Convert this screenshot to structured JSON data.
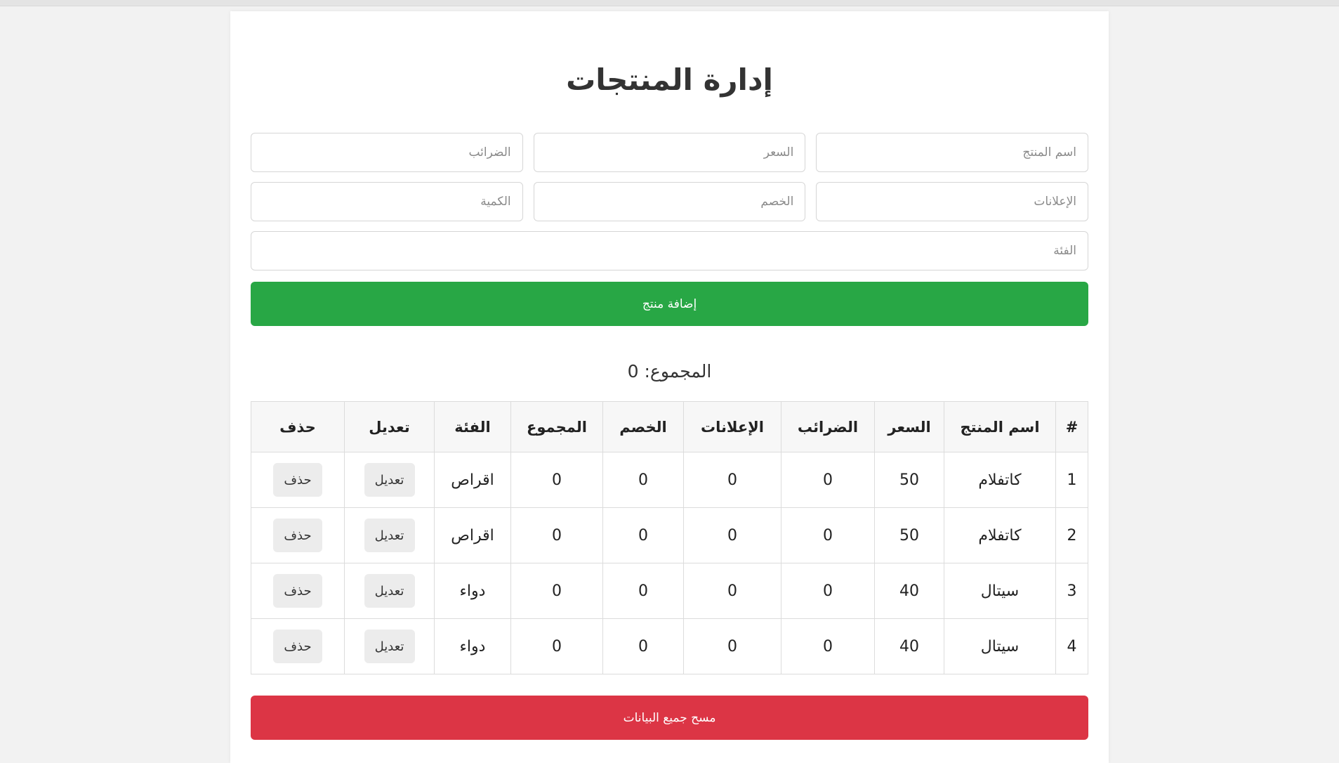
{
  "page": {
    "title": "إدارة المنتجات",
    "total_label": "المجموع: 0"
  },
  "form": {
    "product_name_placeholder": "اسم المنتج",
    "price_placeholder": "السعر",
    "taxes_placeholder": "الضرائب",
    "ads_placeholder": "الإعلانات",
    "discount_placeholder": "الخصم",
    "quantity_placeholder": "الكمية",
    "category_placeholder": "الفئة",
    "add_button_label": "إضافة منتج"
  },
  "table": {
    "headers": [
      "#",
      "اسم المنتج",
      "السعر",
      "الضرائب",
      "الإعلانات",
      "الخصم",
      "المجموع",
      "الفئة",
      "تعديل",
      "حذف"
    ],
    "rows": [
      {
        "id": "1",
        "name": "كاتفلام",
        "price": "50",
        "taxes": "0",
        "ads": "0",
        "discount": "0",
        "total": "0",
        "category": "اقراص",
        "edit_label": "تعديل",
        "delete_label": "حذف"
      },
      {
        "id": "2",
        "name": "كاتفلام",
        "price": "50",
        "taxes": "0",
        "ads": "0",
        "discount": "0",
        "total": "0",
        "category": "اقراص",
        "edit_label": "تعديل",
        "delete_label": "حذف"
      },
      {
        "id": "3",
        "name": "سيتال",
        "price": "40",
        "taxes": "0",
        "ads": "0",
        "discount": "0",
        "total": "0",
        "category": "دواء",
        "edit_label": "تعديل",
        "delete_label": "حذف"
      },
      {
        "id": "4",
        "name": "سيتال",
        "price": "40",
        "taxes": "0",
        "ads": "0",
        "discount": "0",
        "total": "0",
        "category": "دواء",
        "edit_label": "تعديل",
        "delete_label": "حذف"
      }
    ]
  },
  "actions": {
    "clear_all_label": "مسح جميع البيانات"
  },
  "colors": {
    "add_button": "#28a745",
    "clear_button": "#dc3545"
  }
}
